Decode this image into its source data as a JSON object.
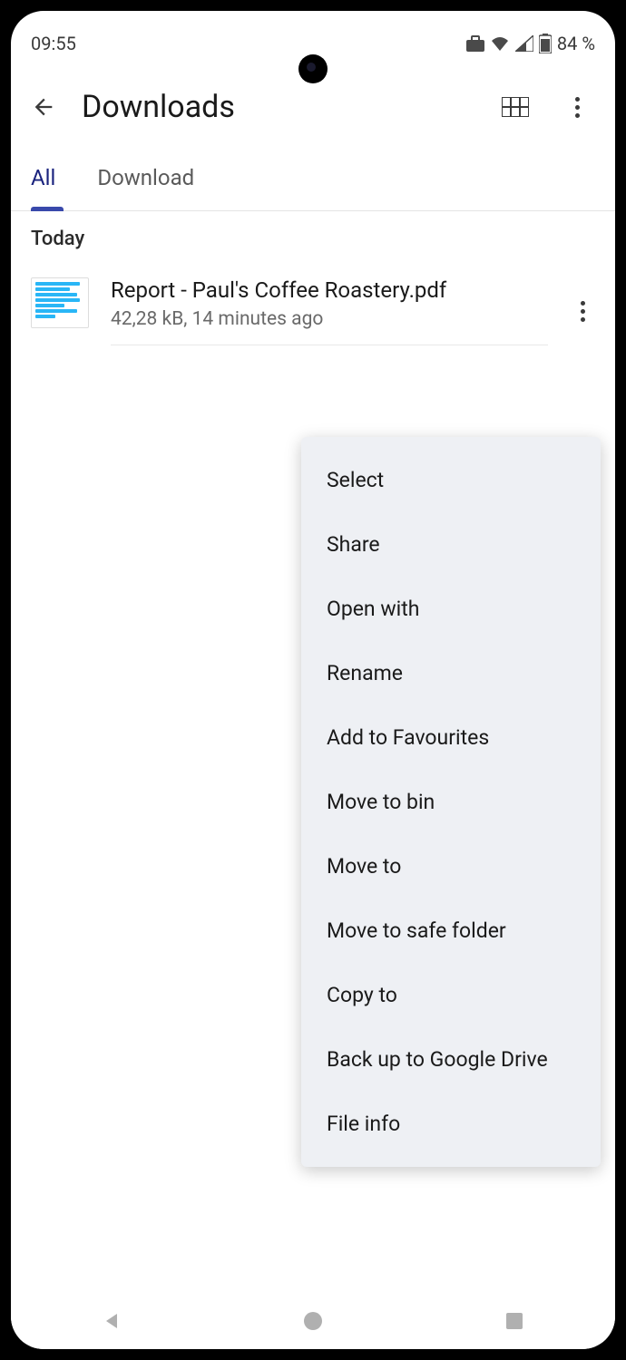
{
  "status": {
    "time": "09:55",
    "battery_pct": "84 %"
  },
  "header": {
    "title": "Downloads"
  },
  "tabs": {
    "all": "All",
    "download": "Download"
  },
  "section": {
    "today": "Today"
  },
  "file": {
    "name": "Report - Paul's Coffee Roastery.pdf",
    "meta": "42,28 kB, 14 minutes ago"
  },
  "menu": {
    "select": "Select",
    "share": "Share",
    "open_with": "Open with",
    "rename": "Rename",
    "add_fav": "Add to Favourites",
    "move_bin": "Move to bin",
    "move_to": "Move to",
    "move_safe": "Move to safe folder",
    "copy_to": "Copy to",
    "backup": "Back up to Google Drive",
    "file_info": "File info"
  }
}
